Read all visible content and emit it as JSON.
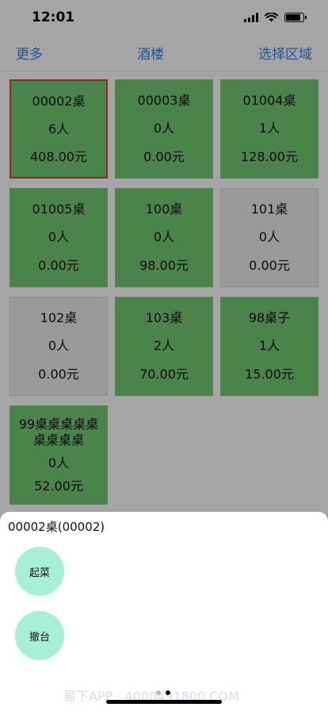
{
  "status": {
    "time": "12:01"
  },
  "nav": {
    "left": "更多",
    "title": "酒楼",
    "right": "选择区域"
  },
  "tables": [
    {
      "name": "00002桌",
      "people": "6人",
      "amount": "408.00元",
      "state": "busy",
      "selected": true
    },
    {
      "name": "00003桌",
      "people": "0人",
      "amount": "0.00元",
      "state": "busy",
      "selected": false
    },
    {
      "name": "01004桌",
      "people": "1人",
      "amount": "128.00元",
      "state": "busy",
      "selected": false
    },
    {
      "name": "01005桌",
      "people": "0人",
      "amount": "0.00元",
      "state": "busy",
      "selected": false
    },
    {
      "name": "100桌",
      "people": "0人",
      "amount": "98.00元",
      "state": "busy",
      "selected": false
    },
    {
      "name": "101桌",
      "people": "0人",
      "amount": "0.00元",
      "state": "free",
      "selected": false
    },
    {
      "name": "102桌",
      "people": "0人",
      "amount": "0.00元",
      "state": "free",
      "selected": false
    },
    {
      "name": "103桌",
      "people": "2人",
      "amount": "70.00元",
      "state": "busy",
      "selected": false
    },
    {
      "name": "98桌子",
      "people": "1人",
      "amount": "15.00元",
      "state": "busy",
      "selected": false
    },
    {
      "name": "99桌桌桌桌桌桌桌桌桌",
      "people": "0人",
      "amount": "52.00元",
      "state": "busy",
      "selected": false
    }
  ],
  "sheet": {
    "title": "00002桌(00002)",
    "actions": [
      "起菜",
      "撤台"
    ],
    "watermark": "易下APP · 4000491800.COM"
  }
}
